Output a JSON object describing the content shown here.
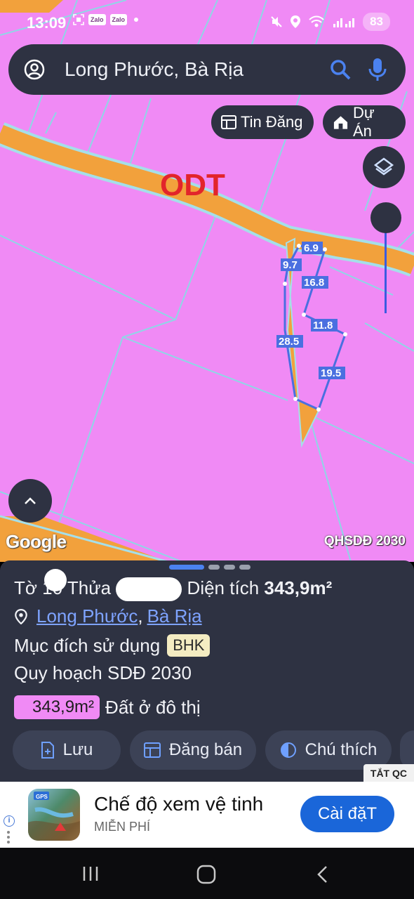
{
  "status": {
    "time": "13:09",
    "app_badges": [
      "Zalo",
      "Zalo"
    ],
    "battery": "83"
  },
  "search": {
    "query": "Long Phước, Bà Rịa"
  },
  "chips": {
    "news": "Tin Đăng",
    "project": "Dự Án"
  },
  "map": {
    "zone_label": "ODT",
    "google": "Google",
    "plan_label": "QHSDĐ 2030",
    "dimensions": [
      "6.9",
      "9.7",
      "16.8",
      "11.8",
      "28.5",
      "19.5"
    ],
    "colors": {
      "land": "#f08af5",
      "road": "#f2a13c",
      "boundary": "#4a6fe0"
    }
  },
  "sheet": {
    "sheet_prefix": "Tờ 1",
    "sheet_digit": "0",
    "parcel_label": "Thửa",
    "area_label": "Diện tích",
    "area_value": "343,9m²",
    "location_ward": "Long Phước",
    "location_sep": ",",
    "location_city": "Bà Rịa",
    "purpose_label": "Mục đích sử dụng",
    "purpose_value": "BHK",
    "plan_line": "Quy hoạch SDĐ 2030",
    "plan_area": "343,9m²",
    "plan_type": "Đất ở đô thị"
  },
  "actions": {
    "save": "Lưu",
    "sell": "Đăng bán",
    "legend": "Chú thích"
  },
  "ad": {
    "close_label": "TẮT QC",
    "title": "Chế độ xem vệ tinh",
    "subtitle": "MIỄN PHÍ",
    "install": "Cài đặT",
    "app_icon_text": "GPS"
  }
}
